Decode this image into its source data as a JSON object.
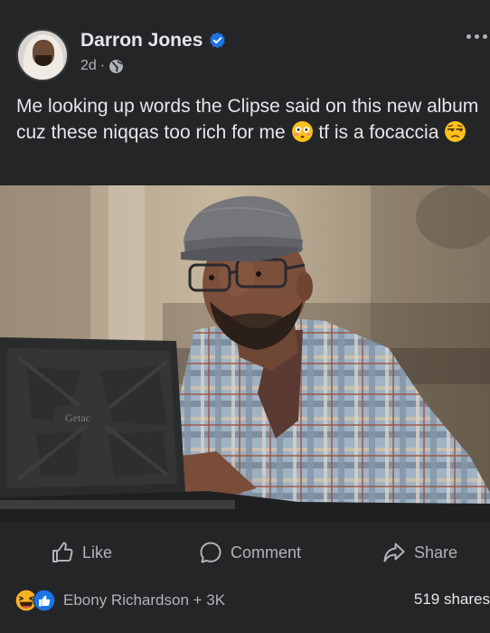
{
  "post": {
    "author": "Darron Jones",
    "time": "2d",
    "separator": "·",
    "text_part1": "Me looking up words the Clipse said on this new album cuz these niqqas too rich for me",
    "text_part2": "tf is a focaccia"
  },
  "photo": {
    "laptop_brand": "Getac"
  },
  "actions": {
    "like": "Like",
    "comment": "Comment",
    "share": "Share"
  },
  "footer": {
    "reaction_summary": "Ebony Richardson + 3K",
    "shares": "519 shares"
  },
  "colors": {
    "background": "#242526",
    "text": "#e4e6eb",
    "secondary": "#b0b3b8",
    "verified": "#1b74e4"
  }
}
